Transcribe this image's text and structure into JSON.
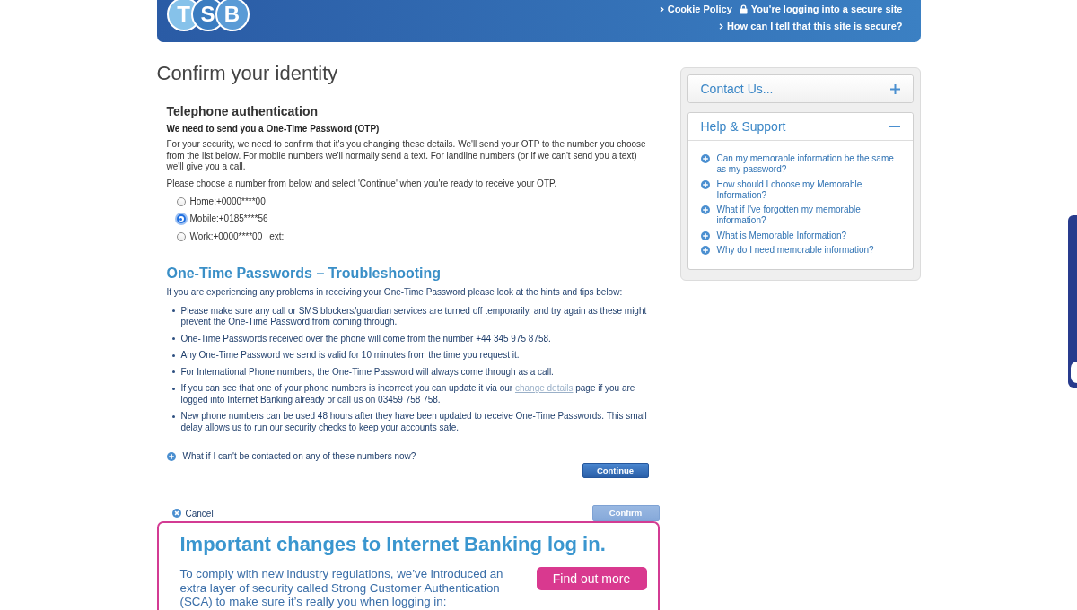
{
  "header": {
    "logo": [
      "T",
      "S",
      "B"
    ],
    "link_rows": [
      [
        {
          "kind": "chevron",
          "text": "Cookie Policy"
        },
        {
          "kind": "lock",
          "text": "You're logging into a secure site"
        }
      ],
      [
        {
          "kind": "chevron",
          "text": "How can I tell that this site is secure?"
        }
      ]
    ]
  },
  "page_title": "Confirm your identity",
  "telephone": {
    "heading": "Telephone authentication",
    "subheading": "We need to send you a One-Time Password (OTP)",
    "intro": "For your security, we need to confirm that it's you changing these details. We'll send your OTP to the number you choose from the list below. For mobile numbers we'll normally send a text. For landline numbers (or if we can't send you a text) we'll give you a call.",
    "instruction": "Please choose a number from below and select 'Continue' when you're ready to receive your OTP.",
    "options": [
      {
        "label": "Home:+0000****00",
        "selected": false
      },
      {
        "label": "Mobile:+0185****56",
        "selected": true
      },
      {
        "label": "Work:+0000****00",
        "extension": "ext:",
        "selected": false
      }
    ]
  },
  "troubleshooting": {
    "heading": "One-Time Passwords – Troubleshooting",
    "intro": "If you are experiencing any problems in receiving your One-Time Password please look at the hints and tips below:",
    "tips": [
      {
        "text": "Please make sure any call or SMS blockers/guardian services are turned off temporarily, and try again as these might prevent the One-Time Password from coming through."
      },
      {
        "text": "One-Time Passwords received over the phone will come from the number +44 345 975 8758."
      },
      {
        "text": "Any One-Time Password we send is valid for 10 minutes from the time you request it."
      },
      {
        "text": "For International Phone numbers, the One-Time Password will always come through as a call."
      },
      {
        "text": "If you can see that one of your phone numbers is incorrect you can update it via our",
        "link": "change details",
        "text_after": "page if you are logged into Internet Banking already or call us on 03459 758 758."
      },
      {
        "text": "New phone numbers can be used 48 hours after they have been updated to receive One-Time Passwords. This small delay allows us to run our security checks to keep your accounts safe."
      }
    ],
    "question": {
      "text": "What if I can't be contacted on any of these numbers now?",
      "expanded": false
    }
  },
  "continue_button": "Continue",
  "cancel": "Cancel",
  "confirm_button": {
    "label": "Confirm",
    "disabled": true
  },
  "banner": {
    "title": "Important changes to Internet Banking log in.",
    "text": "To comply with new industry regulations, we’ve introduced an extra layer of security called Strong Customer Authentication (SCA) to make sure it’s really you when logging in:",
    "button": "Find out more"
  },
  "sidebar": {
    "panels": [
      {
        "title": "Contact Us...",
        "expanded": false
      },
      {
        "title": "Help & Support",
        "expanded": true,
        "items": [
          "Can my memorable information be the same as my password?",
          "How should I choose my Memorable Information?",
          "What if I've forgotten my memorable information?",
          "What is Memorable Information?",
          "Why do I need memorable information?"
        ]
      }
    ]
  }
}
